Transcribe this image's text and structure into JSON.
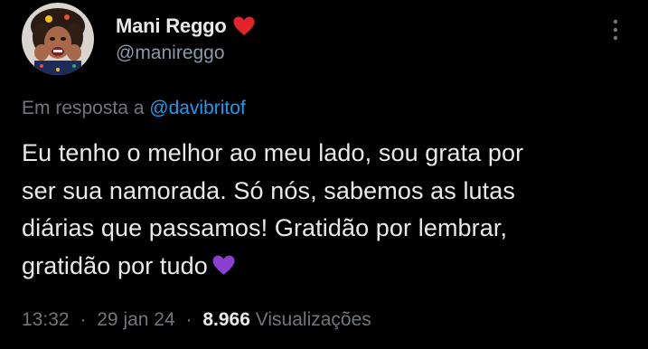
{
  "author": {
    "display_name": "Mani Reggo",
    "name_emoji": "red-heart-icon",
    "handle": "@manireggo"
  },
  "reply": {
    "prefix": "Em resposta a",
    "mention": "@davibritof"
  },
  "tweet": {
    "lines": [
      "Eu tenho o melhor ao meu lado, sou grata por",
      "ser sua namorada. Só nós, sabemos as lutas",
      "diárias que passamos! Gratidão por lembrar,",
      "gratidão por tudo"
    ],
    "trailing_emoji": "purple-heart-icon"
  },
  "meta": {
    "time": "13:32",
    "date": "29 jan 24",
    "separator": "·",
    "views": "8.966",
    "views_label": "Visualizações"
  },
  "colors": {
    "background": "#000000",
    "text": "#e7e9ea",
    "secondary": "#71767b",
    "link": "#1d9bf0",
    "red_heart": "#e0242b",
    "purple_heart": "#8a3fd1"
  }
}
